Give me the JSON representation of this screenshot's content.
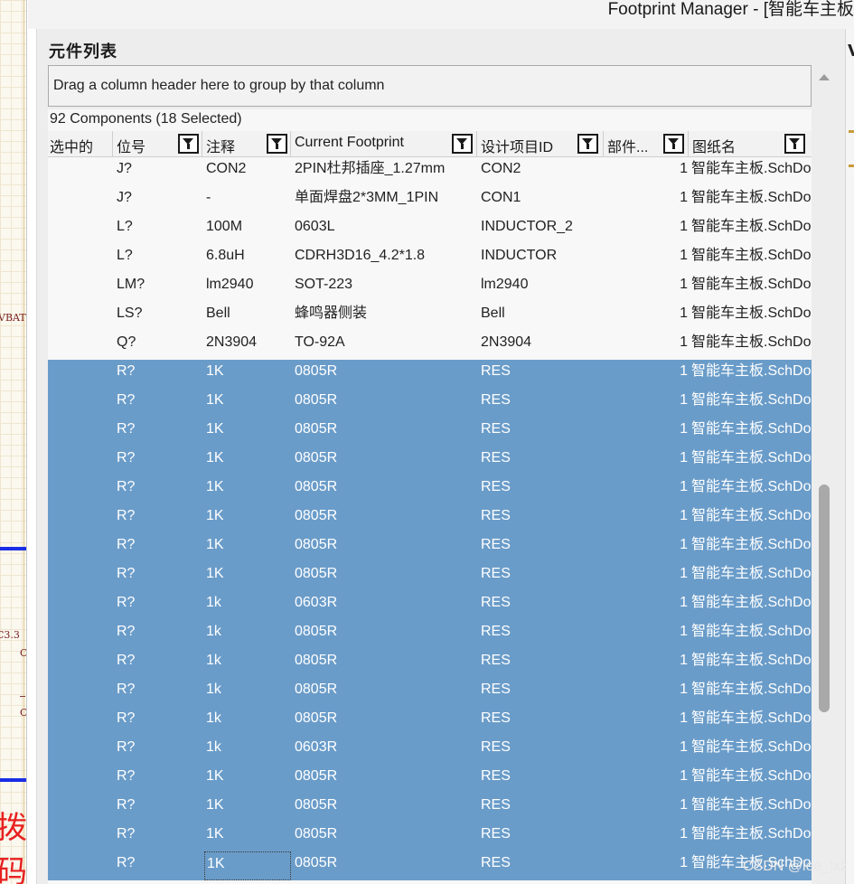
{
  "window": {
    "title": "Footprint Manager - [智能车主板"
  },
  "schematic": {
    "net_labels": [
      "VBAT",
      "C3.3"
    ],
    "fragment_chars": [
      "C",
      "C"
    ],
    "big_text": "拨码"
  },
  "panel": {
    "title": "元件列表",
    "right_peek_title": "V"
  },
  "group_box": {
    "hint": "Drag a column header here to group by that column"
  },
  "status": {
    "count": "92 Components (18 Selected)"
  },
  "columns": [
    "选中的",
    "位号",
    "注释",
    "Current Footprint",
    "设计项目ID",
    "部件...",
    "图纸名"
  ],
  "rows": [
    {
      "selected": false,
      "designator": "J?",
      "comment": "CON2",
      "footprint": "2PIN杜邦插座_1.27mm",
      "design_id": "CON2",
      "part": "1",
      "sheet": "智能车主板.SchDoc"
    },
    {
      "selected": false,
      "designator": "J?",
      "comment": "-",
      "footprint": "单面焊盘2*3MM_1PIN",
      "design_id": "CON1",
      "part": "1",
      "sheet": "智能车主板.SchDoc"
    },
    {
      "selected": false,
      "designator": "L?",
      "comment": "100M",
      "footprint": "0603L",
      "design_id": "INDUCTOR_2",
      "part": "1",
      "sheet": "智能车主板.SchDoc"
    },
    {
      "selected": false,
      "designator": "L?",
      "comment": "6.8uH",
      "footprint": "CDRH3D16_4.2*1.8",
      "design_id": "INDUCTOR",
      "part": "1",
      "sheet": "智能车主板.SchDoc"
    },
    {
      "selected": false,
      "designator": "LM?",
      "comment": "lm2940",
      "footprint": "SOT-223",
      "design_id": "lm2940",
      "part": "1",
      "sheet": "智能车主板.SchDoc"
    },
    {
      "selected": false,
      "designator": "LS?",
      "comment": "Bell",
      "footprint": "蜂鸣器侧装",
      "design_id": "Bell",
      "part": "1",
      "sheet": "智能车主板.SchDoc"
    },
    {
      "selected": false,
      "designator": "Q?",
      "comment": "2N3904",
      "footprint": "TO-92A",
      "design_id": "2N3904",
      "part": "1",
      "sheet": "智能车主板.SchDoc"
    },
    {
      "selected": true,
      "designator": "R?",
      "comment": "1K",
      "footprint": "0805R",
      "design_id": "RES",
      "part": "1",
      "sheet": "智能车主板.SchDoc"
    },
    {
      "selected": true,
      "designator": "R?",
      "comment": "1K",
      "footprint": "0805R",
      "design_id": "RES",
      "part": "1",
      "sheet": "智能车主板.SchDoc"
    },
    {
      "selected": true,
      "designator": "R?",
      "comment": "1K",
      "footprint": "0805R",
      "design_id": "RES",
      "part": "1",
      "sheet": "智能车主板.SchDoc"
    },
    {
      "selected": true,
      "designator": "R?",
      "comment": "1K",
      "footprint": "0805R",
      "design_id": "RES",
      "part": "1",
      "sheet": "智能车主板.SchDoc"
    },
    {
      "selected": true,
      "designator": "R?",
      "comment": "1K",
      "footprint": "0805R",
      "design_id": "RES",
      "part": "1",
      "sheet": "智能车主板.SchDoc"
    },
    {
      "selected": true,
      "designator": "R?",
      "comment": "1K",
      "footprint": "0805R",
      "design_id": "RES",
      "part": "1",
      "sheet": "智能车主板.SchDoc"
    },
    {
      "selected": true,
      "designator": "R?",
      "comment": "1K",
      "footprint": "0805R",
      "design_id": "RES",
      "part": "1",
      "sheet": "智能车主板.SchDoc"
    },
    {
      "selected": true,
      "designator": "R?",
      "comment": "1K",
      "footprint": "0805R",
      "design_id": "RES",
      "part": "1",
      "sheet": "智能车主板.SchDoc"
    },
    {
      "selected": true,
      "designator": "R?",
      "comment": "1k",
      "footprint": "0603R",
      "design_id": "RES",
      "part": "1",
      "sheet": "智能车主板.SchDoc"
    },
    {
      "selected": true,
      "designator": "R?",
      "comment": "1k",
      "footprint": "0805R",
      "design_id": "RES",
      "part": "1",
      "sheet": "智能车主板.SchDoc"
    },
    {
      "selected": true,
      "designator": "R?",
      "comment": "1k",
      "footprint": "0805R",
      "design_id": "RES",
      "part": "1",
      "sheet": "智能车主板.SchDoc"
    },
    {
      "selected": true,
      "designator": "R?",
      "comment": "1k",
      "footprint": "0805R",
      "design_id": "RES",
      "part": "1",
      "sheet": "智能车主板.SchDoc"
    },
    {
      "selected": true,
      "designator": "R?",
      "comment": "1k",
      "footprint": "0805R",
      "design_id": "RES",
      "part": "1",
      "sheet": "智能车主板.SchDoc"
    },
    {
      "selected": true,
      "designator": "R?",
      "comment": "1k",
      "footprint": "0603R",
      "design_id": "RES",
      "part": "1",
      "sheet": "智能车主板.SchDoc"
    },
    {
      "selected": true,
      "designator": "R?",
      "comment": "1K",
      "footprint": "0805R",
      "design_id": "RES",
      "part": "1",
      "sheet": "智能车主板.SchDoc"
    },
    {
      "selected": true,
      "designator": "R?",
      "comment": "1K",
      "footprint": "0805R",
      "design_id": "RES",
      "part": "1",
      "sheet": "智能车主板.SchDoc"
    },
    {
      "selected": true,
      "designator": "R?",
      "comment": "1K",
      "footprint": "0805R",
      "design_id": "RES",
      "part": "1",
      "sheet": "智能车主板.SchDoc"
    },
    {
      "selected": true,
      "designator": "R?",
      "comment": "1K",
      "footprint": "0805R",
      "design_id": "RES",
      "part": "1",
      "sheet": "智能车主板.SchDoc"
    }
  ],
  "watermark": "CSDN @lee_lxz",
  "colors": {
    "selection": "#6a9cc9",
    "schematic_wire": "#1a2de6",
    "schematic_text": "#e82020"
  }
}
